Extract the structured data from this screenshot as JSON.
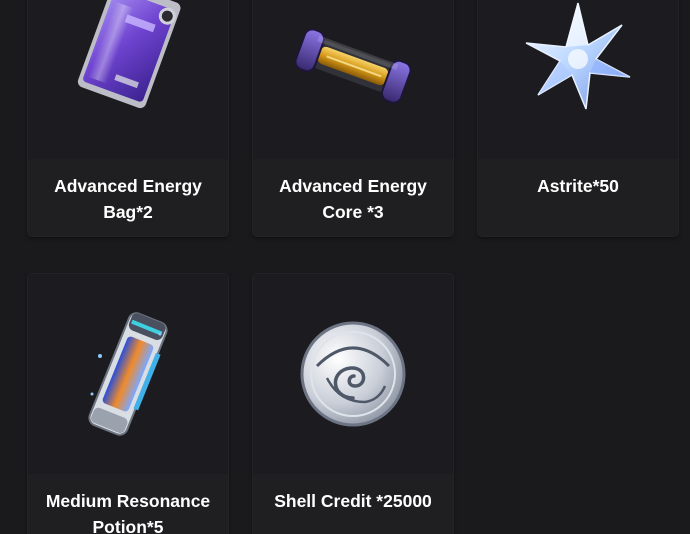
{
  "rewards": {
    "items": [
      {
        "name": "Advanced Energy Bag*2",
        "icon": "purple-energy-bag-icon"
      },
      {
        "name": "Advanced Energy Core *3",
        "icon": "energy-core-capsule-icon"
      },
      {
        "name": "Astrite*50",
        "icon": "astrite-crystal-icon"
      },
      {
        "name": "Medium Resonance Potion*5",
        "icon": "resonance-potion-icon"
      },
      {
        "name": "Shell Credit *25000",
        "icon": "shell-credit-coin-icon"
      }
    ]
  },
  "colors": {
    "background": "#1a1a1c",
    "card": "#1f1f21",
    "text": "#ffffff",
    "accent_purple": "#7b52d9"
  }
}
